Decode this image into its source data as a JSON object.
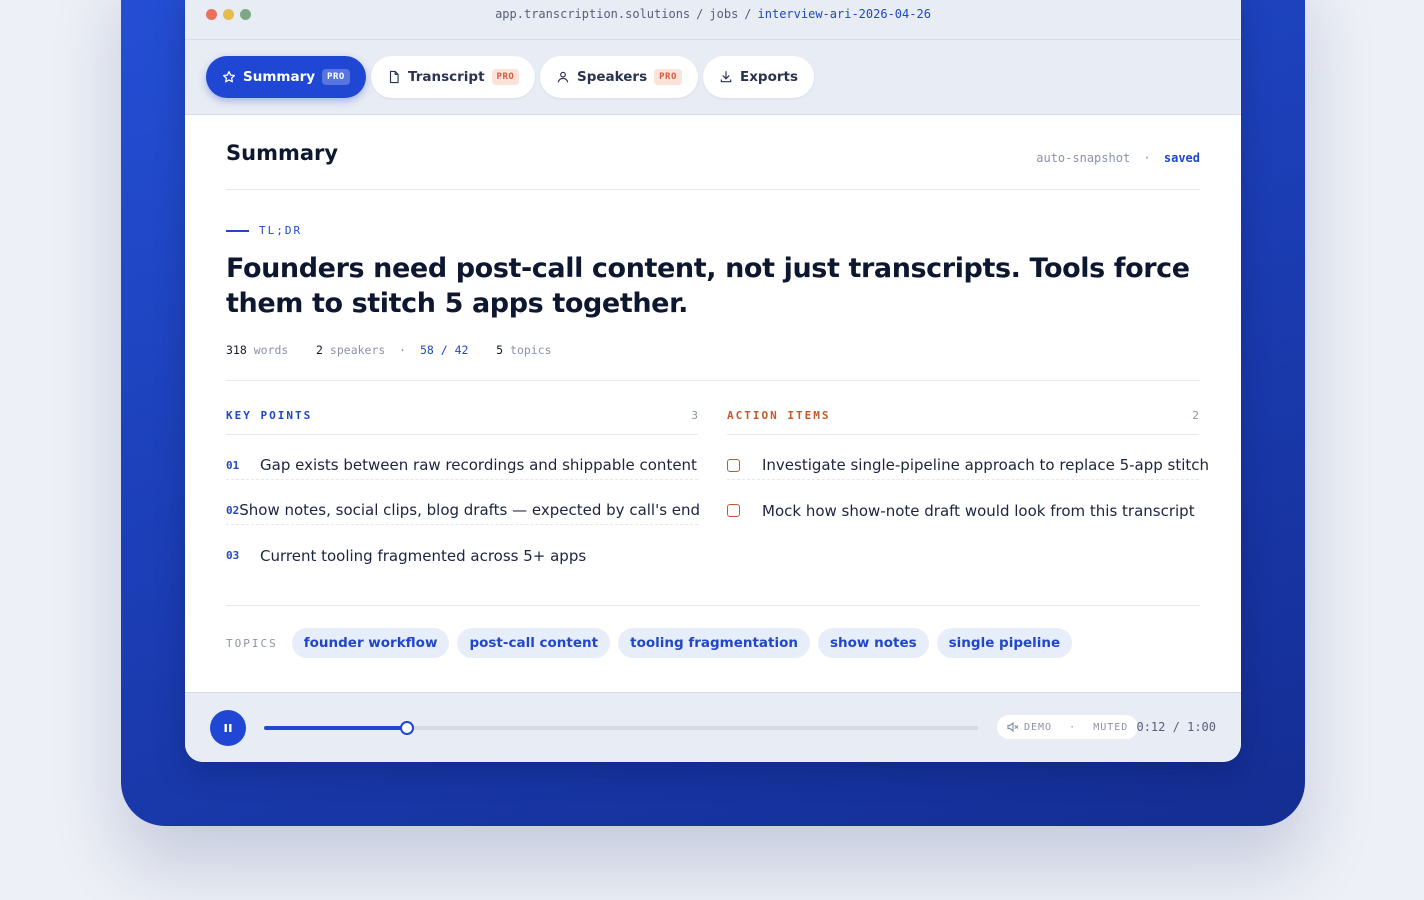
{
  "window": {
    "url_host": "app.transcription.solutions",
    "url_section": "jobs",
    "url_slug": "interview-ari-2026-04-26"
  },
  "tabs": [
    {
      "label": "Summary",
      "badge": "PRO",
      "icon": "star-icon",
      "active": true
    },
    {
      "label": "Transcript",
      "badge": "PRO",
      "icon": "document-icon",
      "active": false
    },
    {
      "label": "Speakers",
      "badge": "PRO",
      "icon": "user-icon",
      "active": false
    },
    {
      "label": "Exports",
      "badge": "",
      "icon": "download-icon",
      "active": false
    }
  ],
  "summary": {
    "title": "Summary",
    "snapshot_label": "auto-snapshot",
    "snapshot_sep": "·",
    "snapshot_status": "saved",
    "tldr_label": "TL;DR",
    "headline": "Founders need post-call content, not just transcripts. Tools force them to stitch 5 apps together.",
    "stats": {
      "words_count": "318",
      "words_label": "words",
      "speakers_count": "2",
      "speakers_label": "speakers",
      "sep": "·",
      "ratio": "58 / 42",
      "topics_count": "5",
      "topics_label": "topics"
    }
  },
  "key_points": {
    "title": "KEY POINTS",
    "count": "3",
    "items": [
      {
        "index": "01",
        "text": "Gap exists between raw recordings and shippable content"
      },
      {
        "index": "02",
        "text": "Show notes, social clips, blog drafts — expected by call's end"
      },
      {
        "index": "03",
        "text": "Current tooling fragmented across 5+ apps"
      }
    ]
  },
  "action_items": {
    "title": "ACTION ITEMS",
    "count": "2",
    "items": [
      {
        "text": "Investigate single-pipeline approach to replace 5-app stitch",
        "checked": false
      },
      {
        "text": "Mock how show-note draft would look from this transcript",
        "checked": false
      }
    ]
  },
  "topics": {
    "label": "TOPICS",
    "chips": [
      "founder workflow",
      "post-call content",
      "tooling fragmentation",
      "show notes",
      "single pipeline"
    ]
  },
  "player": {
    "state_icon": "pause-icon",
    "progress": 0.2,
    "demo_label": "DEMO",
    "sep": "·",
    "muted_label": "MUTED",
    "current_time": "0:12",
    "time_sep": "/",
    "duration": "1:00"
  },
  "colors": {
    "accent": "#1f47d4",
    "action": "#c45a2c",
    "badge_bg": "#fbe3da",
    "backdrop": "#1c3fb8"
  }
}
